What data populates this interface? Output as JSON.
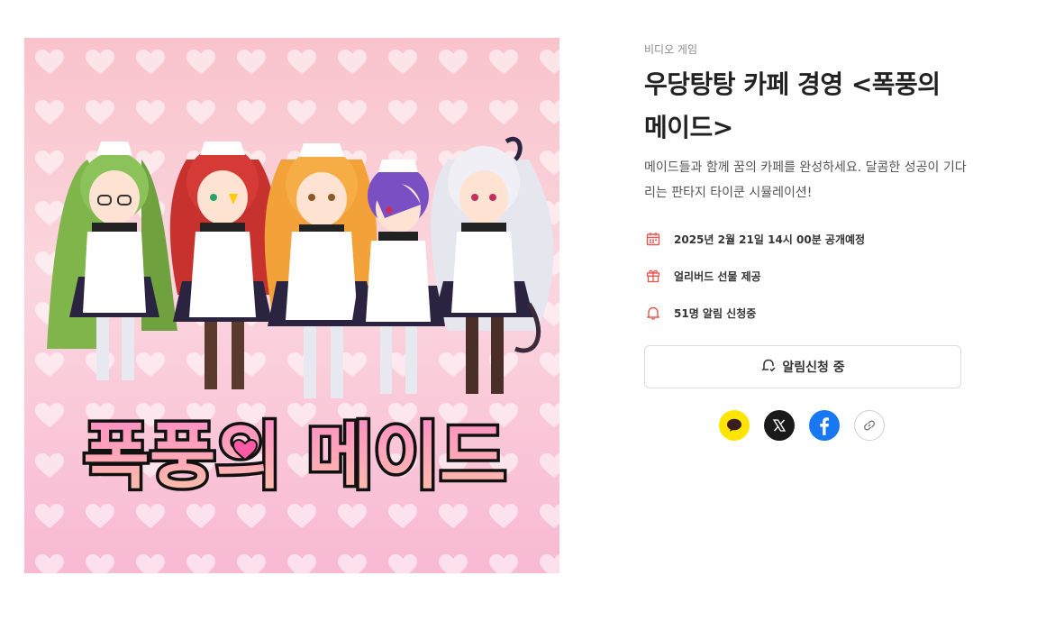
{
  "product": {
    "category": "비디오 게임",
    "title": "우당탕탕 카페 경영 <폭풍의 메이드>",
    "description": "메이드들과 함께 꿈의 카페를 완성하세요. 달콤한 성공이 기다리는 판타지 타이쿤 시뮬레이션!",
    "cover_logo_text": "폭풍의 메이드"
  },
  "meta": {
    "release": {
      "icon": "calendar-icon",
      "text": "2025년 2월 21일 14시 00분 공개예정"
    },
    "gift": {
      "icon": "gift-icon",
      "text": "얼리버드 선물 제공"
    },
    "alerts": {
      "icon": "bell-icon",
      "text": "51명 알림 신청중"
    }
  },
  "notify_button": {
    "icon": "bell-check-icon",
    "label": "알림신청 중"
  },
  "share": [
    {
      "name": "kakao",
      "icon": "kakao-icon",
      "color": "#fee500"
    },
    {
      "name": "x",
      "icon": "x-icon",
      "color": "#1a1a1a"
    },
    {
      "name": "facebook",
      "icon": "facebook-icon",
      "color": "#1877f2"
    },
    {
      "name": "copy-link",
      "icon": "link-icon",
      "color": "#ffffff"
    }
  ],
  "colors": {
    "accent": "#e8574f",
    "text": "#222222",
    "muted": "#8a8a8a"
  }
}
